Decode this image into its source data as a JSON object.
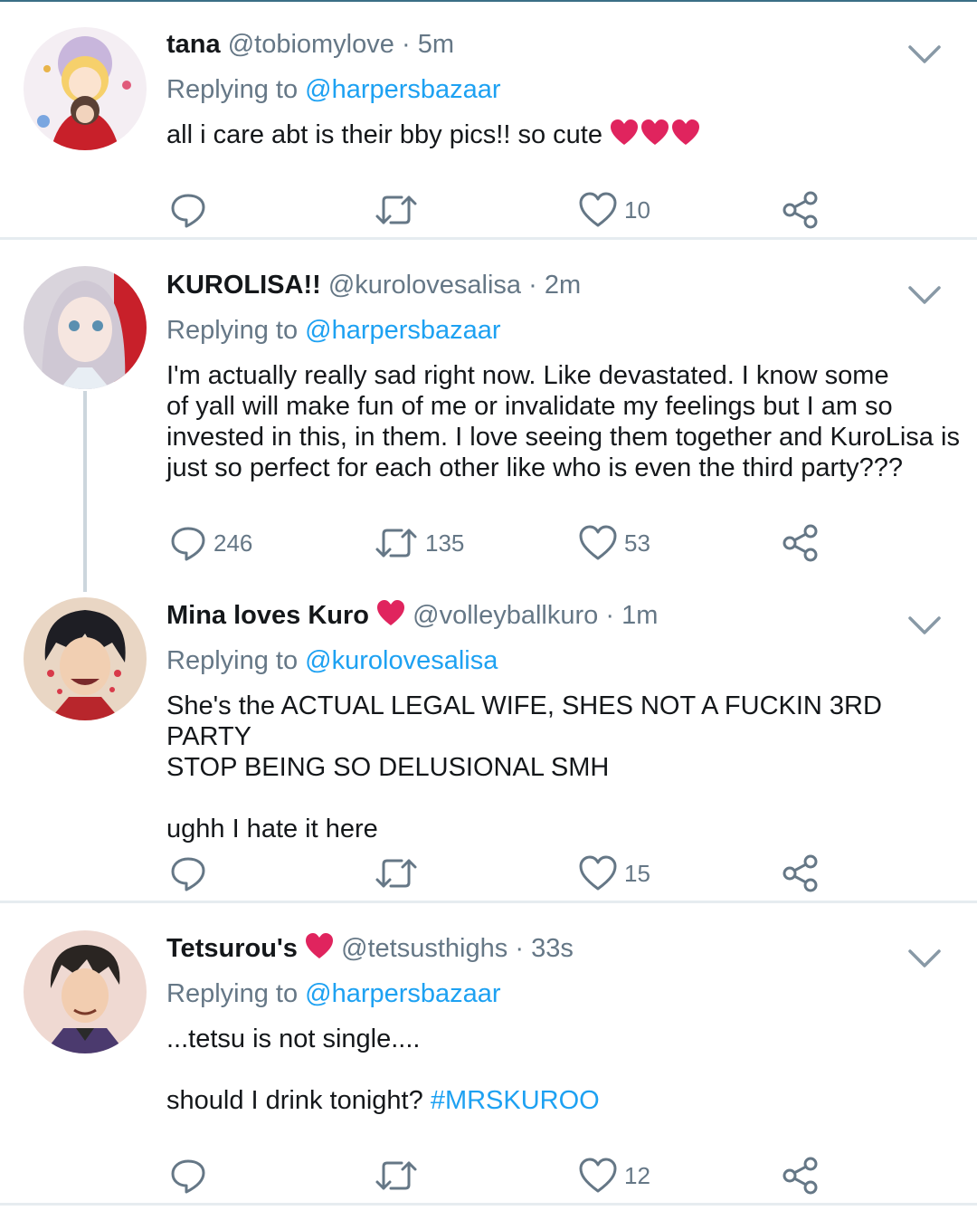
{
  "tweets": [
    {
      "name": "tana",
      "handle": "@tobiomylove",
      "time": "5m",
      "replying_label": "Replying to",
      "replying_to": "@harpersbazaar",
      "text": [
        "all i care abt is their bby pics!! so cute"
      ],
      "text_suffix_emoji": "❤️❤️❤️",
      "replies": "",
      "retweets": "",
      "likes": "10"
    },
    {
      "name": "KUROLISA!!",
      "handle": "@kurolovesalisa",
      "time": "2m",
      "replying_label": "Replying to",
      "replying_to": "@harpersbazaar",
      "text": [
        "I'm actually really sad right now. Like devastated. I know some",
        "of yall will make fun of me or invalidate my feelings but I am so",
        "invested in this, in them. I love seeing them together and KuroLisa is",
        "just so perfect for each other like who is even the third party???"
      ],
      "replies": "246",
      "retweets": "135",
      "likes": "53"
    },
    {
      "name": "Mina loves Kuro",
      "name_emoji": "❤️",
      "handle": "@volleyballkuro",
      "time": "1m",
      "replying_label": "Replying to",
      "replying_to": "@kurolovesalisa",
      "text": [
        "She's the ACTUAL LEGAL WIFE, SHES NOT A FUCKIN 3RD PARTY",
        "STOP BEING SO DELUSIONAL SMH"
      ],
      "text2": "ughh I hate it here",
      "replies": "",
      "retweets": "",
      "likes": "15"
    },
    {
      "name": "Tetsurou's",
      "name_emoji": "❤️",
      "handle": "@tetsusthighs",
      "time": "33s",
      "replying_label": "Replying to",
      "replying_to": "@harpersbazaar",
      "text": [
        "...tetsu is not single...."
      ],
      "text2": "should I drink tonight?",
      "hashtag": "#MRSKUROO",
      "replies": "",
      "retweets": "",
      "likes": "12"
    }
  ],
  "icons": {
    "reply": "reply-icon",
    "retweet": "retweet-icon",
    "like": "like-icon",
    "share": "share-icon",
    "more": "chevron-down-icon"
  },
  "colors": {
    "link": "#1da1f2",
    "secondary_text": "#657786",
    "separator": "#e6ecf0",
    "heart_emoji": "#e0245e"
  }
}
